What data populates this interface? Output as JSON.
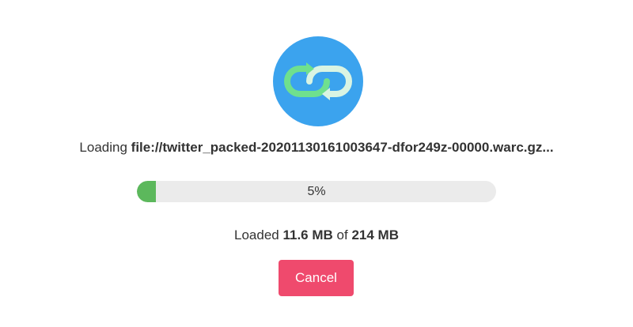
{
  "loading": {
    "prefix": "Loading",
    "file": "file://twitter_packed-20201130161003647-dfor249z-00000.warc.gz..."
  },
  "progress": {
    "label": "5%",
    "fraction": 0.05,
    "fill_color": "#5cb85c",
    "track_color": "#ebebeb"
  },
  "loaded": {
    "prefix": "Loaded",
    "amount": "11.6 MB",
    "of": "of",
    "total": "214 MB"
  },
  "actions": {
    "cancel_label": "Cancel"
  },
  "colors": {
    "logo_bg": "#3ba3ee",
    "link_green": "#6fe08e",
    "link_light": "#d9f4e3",
    "cancel_bg": "#ef4a6d"
  },
  "icons": {
    "logo": "chain-link-icon"
  }
}
